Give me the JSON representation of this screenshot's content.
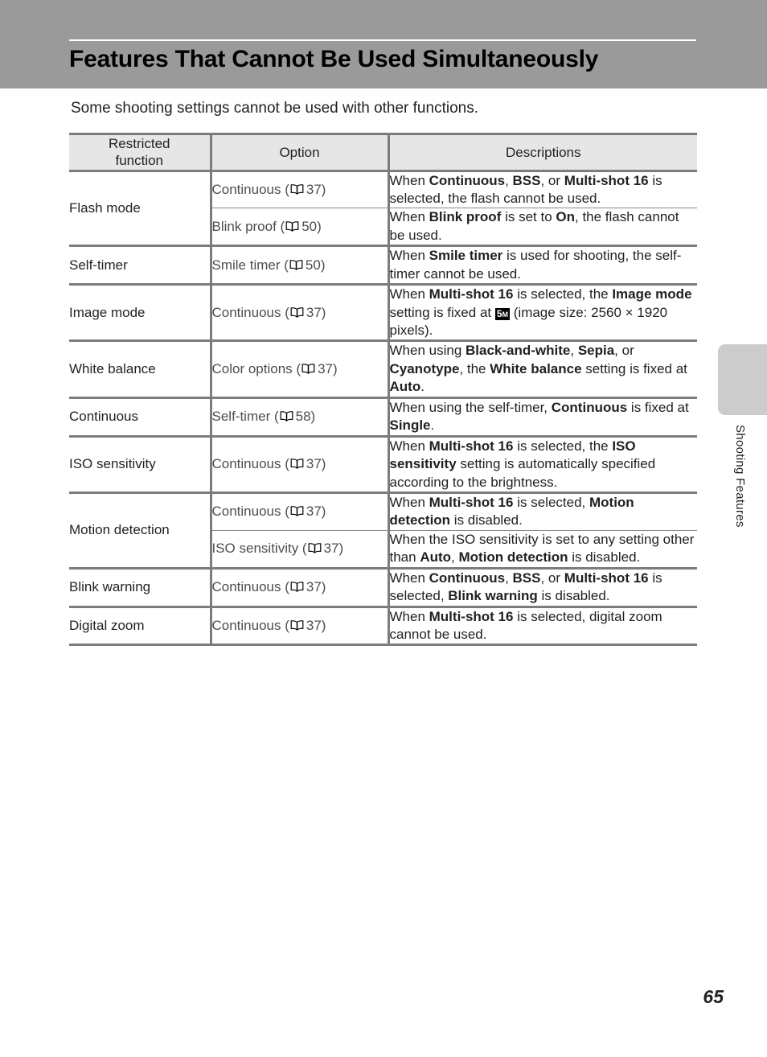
{
  "header": {
    "title": "Features That Cannot Be Used Simultaneously"
  },
  "intro": "Some shooting settings cannot be used with other functions.",
  "table": {
    "columns": [
      "Restricted function",
      "Option",
      "Descriptions"
    ],
    "column_headers": {
      "restricted_function_line1": "Restricted",
      "restricted_function_line2": "function",
      "option": "Option",
      "descriptions": "Descriptions"
    },
    "rows": [
      {
        "function": "Flash mode",
        "entries": [
          {
            "option_label": "Continuous",
            "option_ref_icon": "book-icon",
            "option_ref_page": "37",
            "description_segments": [
              {
                "text": "When ",
                "bold": false
              },
              {
                "text": "Continuous",
                "bold": true
              },
              {
                "text": ", ",
                "bold": false
              },
              {
                "text": "BSS",
                "bold": true
              },
              {
                "text": ", or ",
                "bold": false
              },
              {
                "text": "Multi-shot 16",
                "bold": true
              },
              {
                "text": " is selected, the flash cannot be used.",
                "bold": false
              }
            ]
          },
          {
            "option_label": "Blink proof",
            "option_ref_icon": "book-icon",
            "option_ref_page": "50",
            "description_segments": [
              {
                "text": "When ",
                "bold": false
              },
              {
                "text": "Blink proof",
                "bold": true
              },
              {
                "text": " is set to ",
                "bold": false
              },
              {
                "text": "On",
                "bold": true
              },
              {
                "text": ", the flash cannot be used.",
                "bold": false
              }
            ]
          }
        ]
      },
      {
        "function": "Self-timer",
        "entries": [
          {
            "option_label": "Smile timer",
            "option_ref_icon": "book-icon",
            "option_ref_page": "50",
            "description_segments": [
              {
                "text": "When ",
                "bold": false
              },
              {
                "text": "Smile timer",
                "bold": true
              },
              {
                "text": " is used for shooting, the self-timer cannot be used.",
                "bold": false
              }
            ]
          }
        ]
      },
      {
        "function": "Image mode",
        "entries": [
          {
            "option_label": "Continuous",
            "option_ref_icon": "book-icon",
            "option_ref_page": "37",
            "description_segments": [
              {
                "text": "When ",
                "bold": false
              },
              {
                "text": "Multi-shot 16",
                "bold": true
              },
              {
                "text": " is selected, the ",
                "bold": false
              },
              {
                "text": "Image mode",
                "bold": true
              },
              {
                "text": " setting is fixed at ",
                "bold": false
              },
              {
                "badge": "5M"
              },
              {
                "text": " (image size: 2560 × 1920 pixels).",
                "bold": false
              }
            ]
          }
        ]
      },
      {
        "function": "White balance",
        "entries": [
          {
            "option_label": "Color options",
            "option_ref_icon": "book-icon",
            "option_ref_page": "37",
            "description_segments": [
              {
                "text": "When using ",
                "bold": false
              },
              {
                "text": "Black-and-white",
                "bold": true
              },
              {
                "text": ", ",
                "bold": false
              },
              {
                "text": "Sepia",
                "bold": true
              },
              {
                "text": ", or ",
                "bold": false
              },
              {
                "text": "Cyanotype",
                "bold": true
              },
              {
                "text": ", the ",
                "bold": false
              },
              {
                "text": "White balance",
                "bold": true
              },
              {
                "text": " setting is fixed at ",
                "bold": false
              },
              {
                "text": "Auto",
                "bold": true
              },
              {
                "text": ".",
                "bold": false
              }
            ]
          }
        ]
      },
      {
        "function": "Continuous",
        "entries": [
          {
            "option_label": "Self-timer",
            "option_ref_icon": "book-icon",
            "option_ref_page": "58",
            "description_segments": [
              {
                "text": "When using the self-timer, ",
                "bold": false
              },
              {
                "text": "Continuous",
                "bold": true
              },
              {
                "text": " is fixed at ",
                "bold": false
              },
              {
                "text": "Single",
                "bold": true
              },
              {
                "text": ".",
                "bold": false
              }
            ]
          }
        ]
      },
      {
        "function": "ISO sensitivity",
        "entries": [
          {
            "option_label": "Continuous",
            "option_ref_icon": "book-icon",
            "option_ref_page": "37",
            "description_segments": [
              {
                "text": "When ",
                "bold": false
              },
              {
                "text": "Multi-shot 16",
                "bold": true
              },
              {
                "text": " is selected, the ",
                "bold": false
              },
              {
                "text": "ISO sensitivity",
                "bold": true
              },
              {
                "text": " setting is automatically specified according to the brightness.",
                "bold": false
              }
            ]
          }
        ]
      },
      {
        "function": "Motion detection",
        "entries": [
          {
            "option_label": "Continuous",
            "option_ref_icon": "book-icon",
            "option_ref_page": "37",
            "description_segments": [
              {
                "text": "When ",
                "bold": false
              },
              {
                "text": "Multi-shot 16",
                "bold": true
              },
              {
                "text": " is selected, ",
                "bold": false
              },
              {
                "text": "Motion detection",
                "bold": true
              },
              {
                "text": " is disabled.",
                "bold": false
              }
            ]
          },
          {
            "option_label": "ISO sensitivity",
            "option_ref_icon": "book-icon",
            "option_ref_page": "37",
            "description_segments": [
              {
                "text": "When the ISO sensitivity is set to any setting other than ",
                "bold": false
              },
              {
                "text": "Auto",
                "bold": true
              },
              {
                "text": ", ",
                "bold": false
              },
              {
                "text": "Motion detection",
                "bold": true
              },
              {
                "text": " is disabled.",
                "bold": false
              }
            ]
          }
        ]
      },
      {
        "function": "Blink warning",
        "entries": [
          {
            "option_label": "Continuous",
            "option_ref_icon": "book-icon",
            "option_ref_page": "37",
            "description_segments": [
              {
                "text": "When ",
                "bold": false
              },
              {
                "text": "Continuous",
                "bold": true
              },
              {
                "text": ", ",
                "bold": false
              },
              {
                "text": "BSS",
                "bold": true
              },
              {
                "text": ", or ",
                "bold": false
              },
              {
                "text": "Multi-shot 16",
                "bold": true
              },
              {
                "text": " is selected, ",
                "bold": false
              },
              {
                "text": "Blink warning",
                "bold": true
              },
              {
                "text": " is disabled.",
                "bold": false
              }
            ]
          }
        ]
      },
      {
        "function": "Digital zoom",
        "entries": [
          {
            "option_label": "Continuous",
            "option_ref_icon": "book-icon",
            "option_ref_page": "37",
            "description_segments": [
              {
                "text": "When ",
                "bold": false
              },
              {
                "text": "Multi-shot 16",
                "bold": true
              },
              {
                "text": " is selected, digital zoom cannot be used.",
                "bold": false
              }
            ]
          }
        ]
      }
    ]
  },
  "thumb_tab": {
    "label": "Shooting Features",
    "color": "#cccccc"
  },
  "page_number": "65",
  "colors": {
    "header_band": "#9a9a9a",
    "table_header_fill": "#e6e6e6",
    "rule": "#7c7c7c",
    "text": "#231f20"
  }
}
